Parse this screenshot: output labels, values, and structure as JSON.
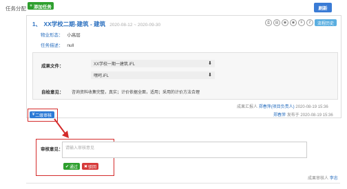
{
  "header": {
    "task_label": "任务分配",
    "add_task": "添加任务",
    "refresh": "刷新"
  },
  "card": {
    "index": "1、",
    "title": "XX学校二期-建筑 - 建筑",
    "dates": "2020-08-12 ~ 2020-09-30",
    "tool_icons": [
      "print-icon",
      "document-icon",
      "view-icon",
      "view-icon",
      "f-icon",
      "z-icon"
    ],
    "history_btn": "流程历史",
    "property_label": "物业形态：",
    "property_value": "小高层",
    "task_desc_label": "任务描述：",
    "task_desc_value": "null",
    "result_files_label": "成果文件：",
    "files": [
      {
        "name": "XX学校一期一建筑.iFL"
      },
      {
        "name": "嘿呵.iFL"
      }
    ],
    "self_check_label": "自检意见：",
    "self_check_value": "咨询资料收集完整，真实；计价依据全面，适用；采用的计价方法合理",
    "reporter_prefix": "成果汇报人",
    "reporter_name": "郑春萍(项目负责人)",
    "reporter_time": "2020-08-19 15:36",
    "publisher_name": "郑春萍",
    "publisher_suffix": "发布于 2020-08-19 15:36"
  },
  "review": {
    "button": "二级审核",
    "opinion_label": "审核意见：",
    "opinion_placeholder": "请输入审核意见",
    "pass": "通过",
    "reject": "驳回",
    "audit_prefix": "成果审核人",
    "audit_name": "李忠"
  },
  "colors": {
    "accent_blue": "#2a6fbf",
    "green": "#2e9f2e",
    "red": "#d63a3a",
    "highlight_red": "#d42a2a"
  }
}
